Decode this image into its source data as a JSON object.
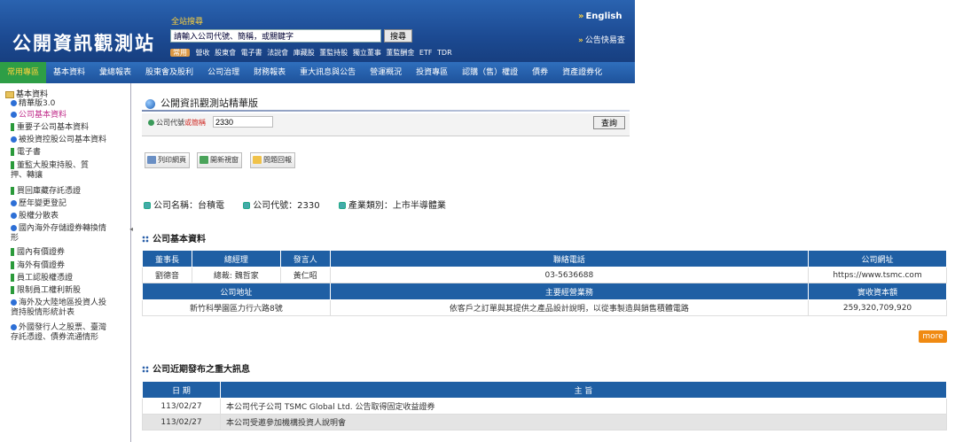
{
  "header": {
    "logo": "公開資訊觀測站",
    "site_search_label": "全站搜尋",
    "search_placeholder": "請輸入公司代號、簡稱，或關鍵字",
    "search_button": "搜尋",
    "quick_tag": "常用",
    "quick_links": [
      "營收",
      "股東會",
      "電子書",
      "法說會",
      "庫藏股",
      "董監持股",
      "獨立董事",
      "董監酬金",
      "ETF",
      "TDR"
    ],
    "english_link": "English",
    "quick_report_link": "公告快易查"
  },
  "nav": {
    "items": [
      "常用專區",
      "基本資料",
      "彙總報表",
      "股東會及股利",
      "公司治理",
      "財務報表",
      "重大訊息與公告",
      "營運概況",
      "投資專區",
      "認購（售）權證",
      "債券",
      "資產證券化"
    ],
    "active_index": 0
  },
  "sidebar": {
    "title": "基本資料",
    "items": [
      {
        "label": "精華版3.0",
        "icon": "blue-dot"
      },
      {
        "label": "公司基本資料",
        "icon": "blue-dot",
        "highlight": true
      },
      {
        "label": "重要子公司基本資料",
        "icon": "green-bar"
      },
      {
        "label": "被投資控股公司基本資料",
        "icon": "blue-dot"
      },
      {
        "label": "電子書",
        "icon": "green-bar"
      },
      {
        "label": "董監大股東持股、質押、轉讓",
        "icon": "green-bar"
      },
      {
        "label": "買回庫藏存託憑證",
        "icon": "green-bar"
      },
      {
        "label": "歷年變更登記",
        "icon": "blue-dot"
      },
      {
        "label": "股權分散表",
        "icon": "blue-dot"
      },
      {
        "label": "國內海外存儲證券轉換情形",
        "icon": "blue-dot"
      },
      {
        "label": "國內有價證券",
        "icon": "green-bar"
      },
      {
        "label": "海外有價證券",
        "icon": "green-bar"
      },
      {
        "label": "員工認股權憑證",
        "icon": "green-bar"
      },
      {
        "label": "限制員工權利新股",
        "icon": "green-bar"
      },
      {
        "label": "海外及大陸地區投資人投資持股情形統計表",
        "icon": "blue-dot"
      },
      {
        "label": "外國發行人之股票、臺灣存託憑證、債券流通情形",
        "icon": "blue-dot"
      }
    ]
  },
  "main": {
    "page_title": "公開資訊觀測站精華版",
    "query_label_prefix": "公司代號",
    "query_label_suffix": "或簡稱",
    "query_value": "2330",
    "query_button": "查詢",
    "tools": [
      "列印網頁",
      "開新視窗",
      "問題回報"
    ],
    "company_name": "公司名稱：台積電",
    "company_code": "公司代號：2330",
    "company_industry": "產業類別：上市半導體業",
    "basic_section_title": "公司基本資料",
    "basic_headers_1": [
      "董事長",
      "總經理",
      "發言人",
      "聯絡電話",
      "公司網址"
    ],
    "basic_row_1": [
      "劉德音",
      "總裁: 魏哲家",
      "黃仁昭",
      "03-5636688",
      "https://www.tsmc.com"
    ],
    "basic_headers_2": [
      "公司地址",
      "主要經營業務",
      "實收資本額"
    ],
    "basic_row_2": [
      "新竹科學園區力行六路8號",
      "依客戶之訂單與其提供之產品設計說明，以從事製造與銷售積體電路",
      "259,320,709,920"
    ],
    "more_button": "more",
    "news_section_title": "公司近期發布之重大訊息",
    "news_headers": [
      "日 期",
      "主 旨"
    ],
    "news_rows": [
      {
        "date": "113/02/27",
        "subject": "本公司代子公司 TSMC Global Ltd. 公告取得固定收益證券"
      },
      {
        "date": "113/02/27",
        "subject": "本公司受邀參加機構投資人說明會"
      }
    ]
  }
}
